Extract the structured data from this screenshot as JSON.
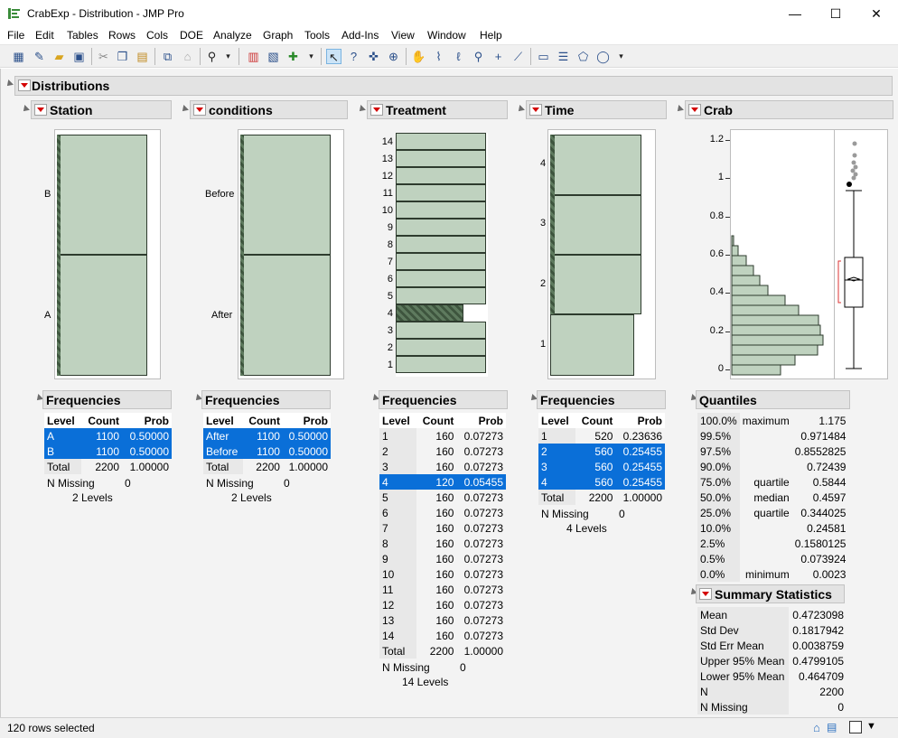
{
  "window": {
    "title": "CrabExp - Distribution - JMP Pro",
    "minimize": "—",
    "maximize": "☐",
    "close": "✕"
  },
  "menu": [
    "File",
    "Edit",
    "Tables",
    "Rows",
    "Cols",
    "DOE",
    "Analyze",
    "Graph",
    "Tools",
    "Add-Ins",
    "View",
    "Window",
    "Help"
  ],
  "toolbar_icons": [
    "new-data-table-icon",
    "new-script-icon",
    "open-icon",
    "save-icon",
    "cut-icon",
    "copy-icon",
    "paste-icon",
    "script-icon",
    "lock-icon",
    "search-icon",
    "data-table-icon",
    "journal-icon",
    "add-icon",
    "arrow-tool-icon",
    "help-tool-icon",
    "crosshair-icon",
    "grabber-icon",
    "hand-tool-icon",
    "brush-tool-icon",
    "lasso-tool-icon",
    "magnifier-icon",
    "plus-tool-icon",
    "line-tool-icon",
    "text-tool-icon",
    "list-tool-icon",
    "polygon-tool-icon",
    "ellipse-tool-icon"
  ],
  "outline": {
    "title": "Distributions"
  },
  "station": {
    "title": "Station",
    "labels": [
      "B",
      "A"
    ],
    "freq_title": "Frequencies",
    "headers": [
      "Level",
      "Count",
      "Prob"
    ],
    "rows": [
      [
        "A",
        "1100",
        "0.50000"
      ],
      [
        "B",
        "1100",
        "0.50000"
      ]
    ],
    "total": [
      "Total",
      "2200",
      "1.00000"
    ],
    "missing_label": "N Missing",
    "missing": "0",
    "levels": "2  Levels"
  },
  "conditions": {
    "title": "conditions",
    "labels": [
      "Before",
      "After"
    ],
    "freq_title": "Frequencies",
    "headers": [
      "Level",
      "Count",
      "Prob"
    ],
    "rows": [
      [
        "After",
        "1100",
        "0.50000"
      ],
      [
        "Before",
        "1100",
        "0.50000"
      ]
    ],
    "total": [
      "Total",
      "2200",
      "1.00000"
    ],
    "missing_label": "N Missing",
    "missing": "0",
    "levels": "2  Levels"
  },
  "treatment": {
    "title": "Treatment",
    "labels": [
      "14",
      "13",
      "12",
      "11",
      "10",
      "9",
      "8",
      "7",
      "6",
      "5",
      "4",
      "3",
      "2",
      "1"
    ],
    "freq_title": "Frequencies",
    "headers": [
      "Level",
      "Count",
      "Prob"
    ],
    "rows": [
      [
        "1",
        "160",
        "0.07273"
      ],
      [
        "2",
        "160",
        "0.07273"
      ],
      [
        "3",
        "160",
        "0.07273"
      ],
      [
        "4",
        "120",
        "0.05455"
      ],
      [
        "5",
        "160",
        "0.07273"
      ],
      [
        "6",
        "160",
        "0.07273"
      ],
      [
        "7",
        "160",
        "0.07273"
      ],
      [
        "8",
        "160",
        "0.07273"
      ],
      [
        "9",
        "160",
        "0.07273"
      ],
      [
        "10",
        "160",
        "0.07273"
      ],
      [
        "11",
        "160",
        "0.07273"
      ],
      [
        "12",
        "160",
        "0.07273"
      ],
      [
        "13",
        "160",
        "0.07273"
      ],
      [
        "14",
        "160",
        "0.07273"
      ]
    ],
    "total": [
      "Total",
      "2200",
      "1.00000"
    ],
    "missing_label": "N Missing",
    "missing": "0",
    "levels": "14  Levels"
  },
  "time": {
    "title": "Time",
    "labels": [
      "4",
      "3",
      "2",
      "1"
    ],
    "freq_title": "Frequencies",
    "headers": [
      "Level",
      "Count",
      "Prob"
    ],
    "rows": [
      [
        "1",
        "520",
        "0.23636"
      ],
      [
        "2",
        "560",
        "0.25455"
      ],
      [
        "3",
        "560",
        "0.25455"
      ],
      [
        "4",
        "560",
        "0.25455"
      ]
    ],
    "total": [
      "Total",
      "2200",
      "1.00000"
    ],
    "missing_label": "N Missing",
    "missing": "0",
    "levels": "4  Levels"
  },
  "crab": {
    "title": "Crab",
    "ticks": [
      "1.2",
      "1",
      "0.8",
      "0.6",
      "0.4",
      "0.2",
      "0"
    ],
    "quantiles_title": "Quantiles",
    "quantiles": [
      [
        "100.0%",
        "maximum",
        "1.175"
      ],
      [
        "99.5%",
        "",
        "0.971484"
      ],
      [
        "97.5%",
        "",
        "0.8552825"
      ],
      [
        "90.0%",
        "",
        "0.72439"
      ],
      [
        "75.0%",
        "quartile",
        "0.5844"
      ],
      [
        "50.0%",
        "median",
        "0.4597"
      ],
      [
        "25.0%",
        "quartile",
        "0.344025"
      ],
      [
        "10.0%",
        "",
        "0.24581"
      ],
      [
        "2.5%",
        "",
        "0.1580125"
      ],
      [
        "0.5%",
        "",
        "0.073924"
      ],
      [
        "0.0%",
        "minimum",
        "0.0023"
      ]
    ],
    "summary_title": "Summary Statistics",
    "summary": [
      [
        "Mean",
        "0.4723098"
      ],
      [
        "Std Dev",
        "0.1817942"
      ],
      [
        "Std Err Mean",
        "0.0038759"
      ],
      [
        "Upper 95% Mean",
        "0.4799105"
      ],
      [
        "Lower 95% Mean",
        "0.464709"
      ],
      [
        "N",
        "2200"
      ],
      [
        "N Missing",
        "0"
      ]
    ]
  },
  "status": {
    "text": "120 rows selected"
  },
  "colors": {
    "bar_fill": "#bfd2bf",
    "selection": "#0a6fd8",
    "menu_red": "#d40000"
  }
}
